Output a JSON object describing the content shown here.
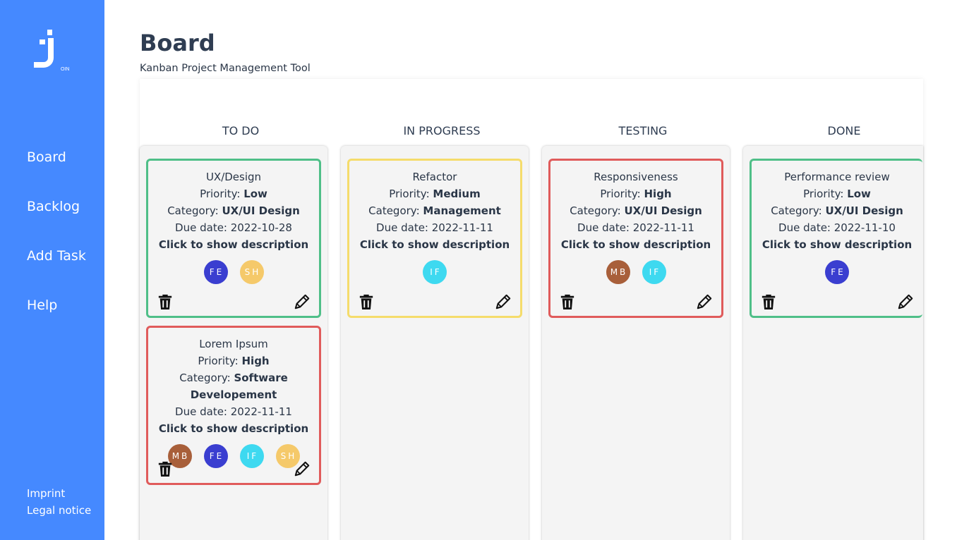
{
  "sidebar": {
    "logo_text": "OIN",
    "nav": [
      {
        "label": "Board"
      },
      {
        "label": "Backlog"
      },
      {
        "label": "Add Task"
      },
      {
        "label": "Help"
      }
    ],
    "footer": {
      "imprint": "Imprint",
      "legal": "Legal notice"
    }
  },
  "header": {
    "title": "Board",
    "subtitle": "Kanban Project Management Tool"
  },
  "labels": {
    "priority": "Priority: ",
    "category": "Category: ",
    "due": "Due date: ",
    "show_desc": "Click to show description"
  },
  "columns": [
    {
      "title": "TO DO",
      "cards": [
        {
          "title": "UX/Design",
          "priority": "Low",
          "category": "UX/UI Design",
          "due": "2022-10-28",
          "border": "#4fbf88",
          "avatars": [
            {
              "initials": "FE",
              "color": "#3a3ed0"
            },
            {
              "initials": "SH",
              "color": "#f5c96a"
            }
          ]
        },
        {
          "title": "Lorem Ipsum",
          "priority": "High",
          "category": "Software Developement",
          "due": "2022-11-11",
          "border": "#e05b5b",
          "avatars": [
            {
              "initials": "MB",
              "color": "#a85f3a"
            },
            {
              "initials": "FE",
              "color": "#3a3ed0"
            },
            {
              "initials": "IF",
              "color": "#3ed9f0"
            },
            {
              "initials": "SH",
              "color": "#f5c96a"
            }
          ]
        }
      ]
    },
    {
      "title": "IN PROGRESS",
      "cards": [
        {
          "title": "Refactor",
          "priority": "Medium",
          "category": "Management",
          "due": "2022-11-11",
          "border": "#f5dc6b",
          "avatars": [
            {
              "initials": "IF",
              "color": "#3ed9f0"
            }
          ]
        }
      ]
    },
    {
      "title": "TESTING",
      "cards": [
        {
          "title": "Responsiveness",
          "priority": "High",
          "category": "UX/UI Design",
          "due": "2022-11-11",
          "border": "#e05b5b",
          "avatars": [
            {
              "initials": "MB",
              "color": "#a85f3a"
            },
            {
              "initials": "IF",
              "color": "#3ed9f0"
            }
          ]
        }
      ]
    },
    {
      "title": "DONE",
      "cards": [
        {
          "title": "Performance review",
          "priority": "Low",
          "category": "UX/UI Design",
          "due": "2022-11-10",
          "border": "#4fbf88",
          "avatars": [
            {
              "initials": "FE",
              "color": "#3a3ed0"
            }
          ]
        }
      ]
    }
  ],
  "icons": {
    "delete": "trash-icon",
    "edit": "pencil-icon"
  },
  "colors": {
    "sidebar": "#4589ff",
    "text": "#2a3647"
  }
}
